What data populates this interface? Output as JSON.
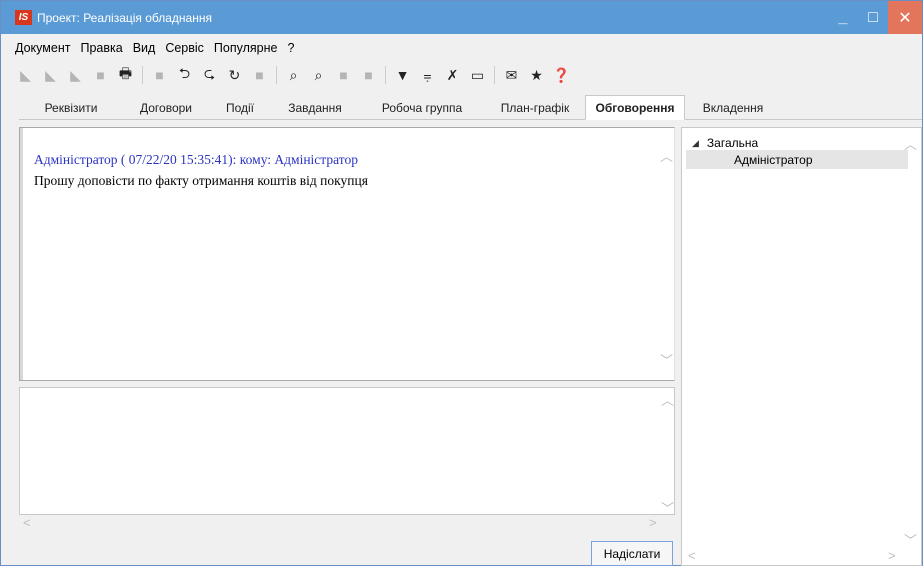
{
  "window": {
    "title": "Проект: Реалізація обладнання",
    "logo_text": "IS",
    "controls": {
      "minimize": "_",
      "maximize": "□",
      "close": "✕"
    }
  },
  "menu": {
    "items": [
      "Документ",
      "Правка",
      "Вид",
      "Сервіс",
      "Популярне",
      "?"
    ]
  },
  "toolbar": {
    "icons": [
      {
        "name": "create-icon",
        "glyph": "◣",
        "state": "disabled"
      },
      {
        "name": "create-copy-icon",
        "glyph": "◣",
        "state": "disabled"
      },
      {
        "name": "edit-icon",
        "glyph": "◣",
        "state": "disabled"
      },
      {
        "name": "delete-icon",
        "glyph": "■",
        "state": "disabled"
      },
      {
        "name": "print-icon",
        "glyph": "🖶",
        "state": "dark"
      },
      {
        "name": "document-icon",
        "glyph": "■",
        "state": "disabled"
      },
      {
        "name": "import-icon",
        "glyph": "⮌",
        "state": "dark"
      },
      {
        "name": "export-icon",
        "glyph": "⮎",
        "state": "dark"
      },
      {
        "name": "refresh-icon",
        "glyph": "↻",
        "state": "dark"
      },
      {
        "name": "table-icon",
        "glyph": "■",
        "state": "disabled"
      },
      {
        "name": "find-icon",
        "glyph": "⌕",
        "state": "dark"
      },
      {
        "name": "find-next-icon",
        "glyph": "⌕",
        "state": "dark"
      },
      {
        "name": "copy-icon",
        "glyph": "■",
        "state": "disabled"
      },
      {
        "name": "grid-icon",
        "glyph": "■",
        "state": "disabled"
      },
      {
        "name": "filter-icon",
        "glyph": "▼",
        "state": "dark"
      },
      {
        "name": "filter-apply-icon",
        "glyph": "⩦",
        "state": "dark"
      },
      {
        "name": "filter-clear-icon",
        "glyph": "✗",
        "state": "dark"
      },
      {
        "name": "attach-icon",
        "glyph": "▭",
        "state": "dark"
      },
      {
        "name": "mail-icon",
        "glyph": "✉",
        "state": "dark"
      },
      {
        "name": "favorite-icon",
        "glyph": "★",
        "state": "dark"
      },
      {
        "name": "help-icon",
        "glyph": "❓",
        "state": "dark"
      }
    ]
  },
  "tabs": [
    {
      "label": "Реквізити",
      "width": 104
    },
    {
      "label": "Договори",
      "width": 86
    },
    {
      "label": "Події",
      "width": 62
    },
    {
      "label": "Завдання",
      "width": 88
    },
    {
      "label": "Робоча группа",
      "width": 126
    },
    {
      "label": "План-графік",
      "width": 100
    },
    {
      "label": "Обговорення",
      "width": 100,
      "active": true
    },
    {
      "label": "Вкладення",
      "width": 96
    }
  ],
  "messages": {
    "header": "Адміністратор ( 07/22/20 15:35:41): кому: Адміністратор",
    "body": "Прошу доповісти по факту отримання коштів від покупця"
  },
  "input": {
    "value": ""
  },
  "send_button": "Надіслати",
  "tree": {
    "group": "Загальна",
    "toggle": "◢",
    "items": [
      "Адміністратор"
    ]
  },
  "scroll": {
    "up": "︿",
    "down": "﹀",
    "left": "<",
    "right": ">"
  }
}
